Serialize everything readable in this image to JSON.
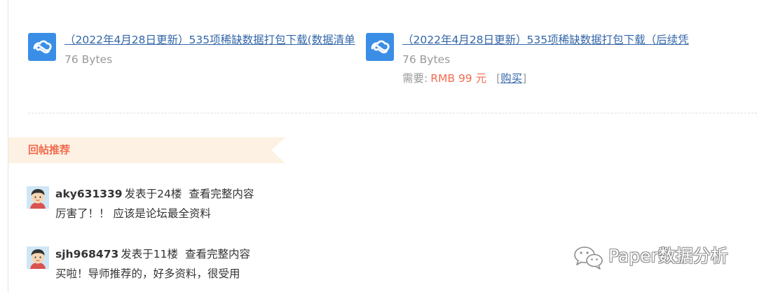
{
  "attachments": [
    {
      "icon": "cloud-icon",
      "name": "（2022年4月28日更新）535项稀缺数据打包下载(数据清单",
      "size": "76 Bytes"
    },
    {
      "icon": "cloud-icon",
      "name": "（2022年4月28日更新）535项稀缺数据打包下载（后续凭",
      "size": "76 Bytes",
      "price_label": "需要:",
      "price_value": "RMB 99 元",
      "buy_open": "[",
      "buy_label": "购买",
      "buy_close": "]"
    }
  ],
  "section": {
    "title": "回帖推荐"
  },
  "replies": [
    {
      "user": "aky631339",
      "floor": "发表于24楼",
      "view_label": "查看完整内容",
      "text": "厉害了！！  应该是论坛最全资料"
    },
    {
      "user": "sjh968473",
      "floor": "发表于11楼",
      "view_label": "查看完整内容",
      "text": "买啦！导师推荐的，好多资料，很受用"
    }
  ],
  "watermark": {
    "icon": "wechat-icon",
    "text": "Paper数据分析"
  },
  "colors": {
    "link": "#3366a8",
    "accent": "#f26c4f",
    "banner": "#fdf1e3",
    "icon_blue": "#3a8ee6",
    "muted": "#999999"
  }
}
